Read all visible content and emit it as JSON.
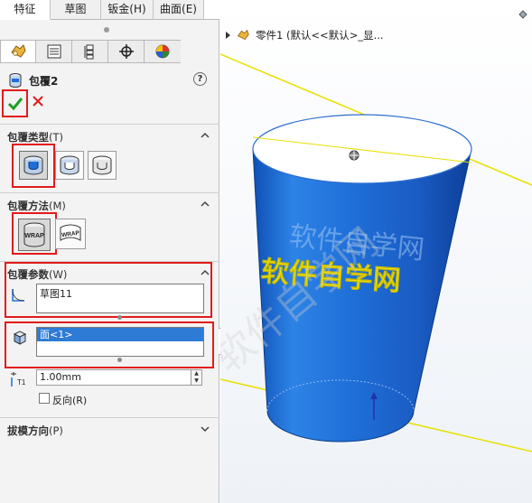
{
  "command_tabs": [
    {
      "label": "特征",
      "active": true
    },
    {
      "label": "草图",
      "active": false
    },
    {
      "label": "钣金(H)",
      "active": false
    },
    {
      "label": "曲面(E)",
      "active": false
    }
  ],
  "property_manager": {
    "feature_name": "包覆2",
    "help_label": "?",
    "tab_icons": [
      "feature-manager-icon",
      "property-manager-icon",
      "configuration-manager-icon",
      "dimxpert-icon",
      "display-manager-icon"
    ]
  },
  "sections": {
    "wrap_type": {
      "label": "包覆类型",
      "key": "(T)"
    },
    "wrap_method": {
      "label": "包覆方法",
      "key": "(M)"
    },
    "wrap_params": {
      "label": "包覆参数",
      "key": "(W)"
    },
    "draft_direction": {
      "label": "拔模方向",
      "key": "(P)"
    }
  },
  "wrap_method_buttons": {
    "wrap_label": "WRAP"
  },
  "params": {
    "sketch_value": "草图11",
    "face_value": "面<1>",
    "thickness_value": "1.00mm",
    "thickness_icon_label": "T1",
    "reverse_label": "反向(R)"
  },
  "tree": {
    "part_label": "零件1 (默认<<默认>_显..."
  },
  "canvas": {
    "emboss_text": "软件自学网",
    "watermark_text": "软件自学网"
  },
  "colors": {
    "accent_red": "#e21b1b",
    "cylinder_blue": "#1f6fd8",
    "selection_blue": "#2e7bd6",
    "plane_yellow": "#e8e000",
    "text_yellow": "#f3f000"
  }
}
